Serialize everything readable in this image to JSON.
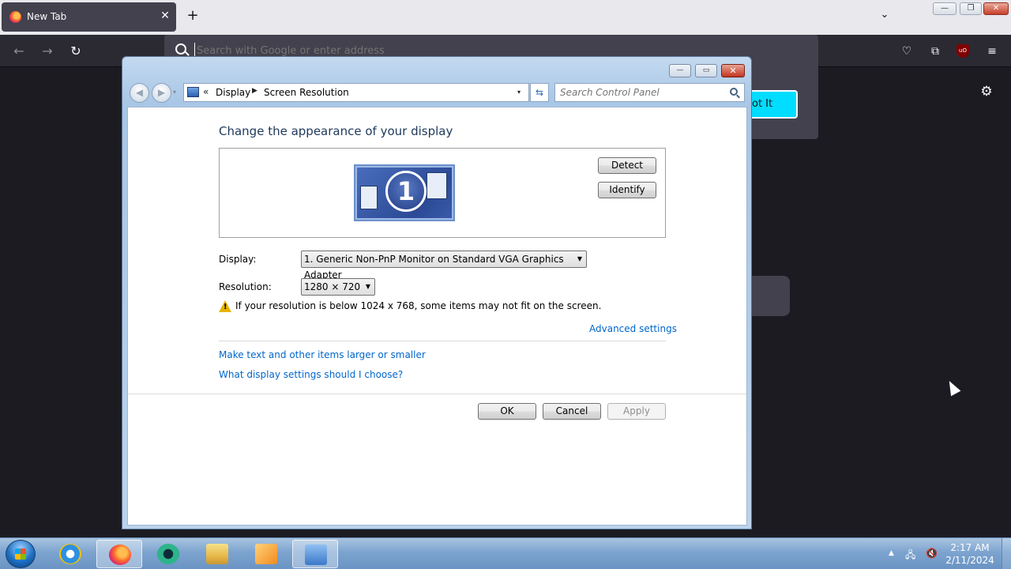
{
  "browser": {
    "tab_title": "New Tab",
    "tab_close": "✕",
    "new_tab": "+",
    "tab_list": "⌄",
    "url_placeholder": "Search with Google or enter address",
    "got_it_label": "ot It",
    "nav": {
      "back": "←",
      "forward": "→",
      "reload": "↻"
    },
    "toolbar_icons": {
      "pocket": "♡",
      "extensions": "⧉",
      "ublock": "uO",
      "menu": "≡",
      "settings": "⚙"
    },
    "window_controls": {
      "minimize": "—",
      "restore": "❐",
      "close": "✕"
    }
  },
  "control_panel": {
    "window_controls": {
      "minimize": "—",
      "maximize": "▭",
      "close": "✕"
    },
    "nav": {
      "back": "◀",
      "forward": "▶",
      "dropdown": "▾"
    },
    "address": {
      "chevron": "«",
      "crumbs": [
        "Display",
        "Screen Resolution"
      ],
      "separator": "▶",
      "dropdown": "▾"
    },
    "refresh": "⇆",
    "search_placeholder": "Search Control Panel",
    "heading": "Change the appearance of your display",
    "monitor_number": "1",
    "detect_label": "Detect",
    "identify_label": "Identify",
    "display_label": "Display:",
    "display_value": "1. Generic Non-PnP Monitor on Standard VGA Graphics Adapter",
    "resolution_label": "Resolution:",
    "resolution_value": "1280 × 720",
    "select_arrow": "▼",
    "warning_text": "If your resolution is below 1024 x 768, some items may not fit on the screen.",
    "advanced_link": "Advanced settings",
    "links": [
      "Make text and other items larger or smaller",
      "What display settings should I choose?"
    ],
    "buttons": {
      "ok": "OK",
      "cancel": "Cancel",
      "apply": "Apply"
    }
  },
  "taskbar": {
    "tray_up": "▲",
    "tray_icons": {
      "network": "🖧",
      "volume": "🔇"
    },
    "time": "2:17 AM",
    "date": "2/11/2024"
  }
}
